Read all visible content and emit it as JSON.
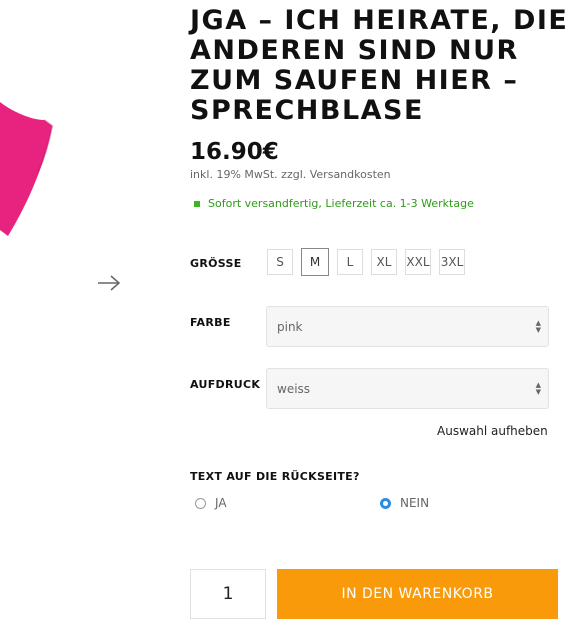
{
  "product": {
    "title": "JGA – ICH HEIRATE, DIE ANDEREN SIND NUR ZUM SAUFEN HIER – SPRECHBLASE",
    "price": "16.90€",
    "vat_note": "inkl. 19% MwSt. zzgl. Versandkosten",
    "stock": "Sofort versandfertig, Lieferzeit ca. 1-3 Werktage",
    "image_color": "#e8237f"
  },
  "options": {
    "size_label": "GRÖSSE",
    "sizes": [
      "S",
      "M",
      "L",
      "XL",
      "XXL",
      "3XL"
    ],
    "selected_size": "M",
    "color_label": "FARBE",
    "color_value": "pink",
    "print_label": "AUFDRUCK",
    "print_value": "weiss",
    "reset_label": "Auswahl aufheben"
  },
  "back_print": {
    "question": "TEXT AUF DIE RÜCKSEITE?",
    "yes_label": "JA",
    "no_label": "NEIN",
    "selected": "NEIN"
  },
  "cart": {
    "quantity": "1",
    "button_label": "IN DEN WARENKORB",
    "button_color": "#f99a0b"
  },
  "gallery": {
    "next_icon": "arrow-right-icon"
  }
}
